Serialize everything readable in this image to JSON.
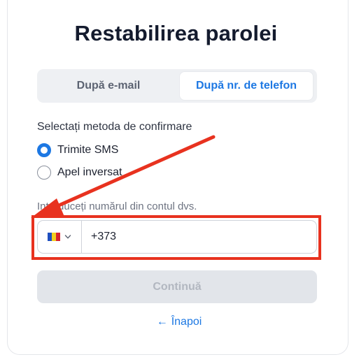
{
  "page": {
    "title": "Restabilirea parolei"
  },
  "tabs": [
    {
      "label": "După e-mail",
      "active": false
    },
    {
      "label": "După nr. de telefon",
      "active": true
    }
  ],
  "confirmation": {
    "label": "Selectați metoda de confirmare",
    "options": [
      {
        "label": "Trimite SMS",
        "checked": true
      },
      {
        "label": "Apel inversat",
        "checked": false
      }
    ]
  },
  "phone": {
    "label": "Introduceți numărul din contul dvs.",
    "country_icon": "moldova-flag-icon",
    "value": "+373"
  },
  "actions": {
    "continue_label": "Continuă",
    "back_label": "Înapoi"
  },
  "colors": {
    "accent": "#1d78e3",
    "annotation": "#e8321f"
  }
}
